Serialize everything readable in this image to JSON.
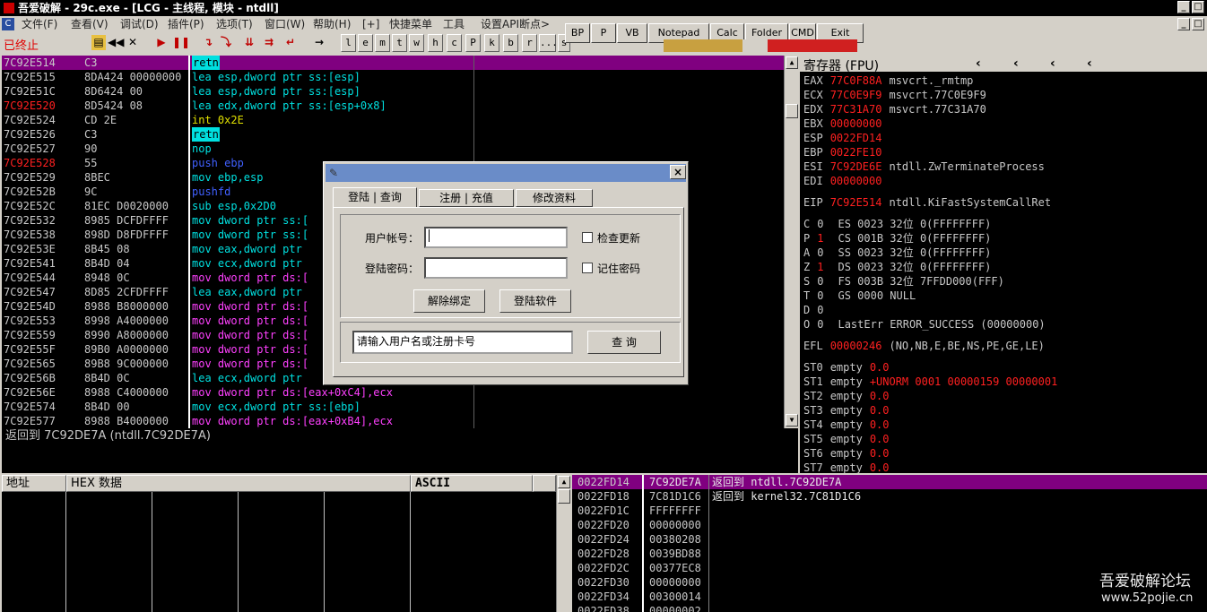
{
  "title": "吾爱破解 - 29c.exe - [LCG - 主线程, 模块 - ntdll]",
  "window_buttons": [
    "_",
    "□"
  ],
  "menu": [
    "文件(F)",
    "查看(V)",
    "调试(D)",
    "插件(P)",
    "选项(T)",
    "窗口(W)",
    "帮助(H)",
    "[+]",
    "快捷菜单",
    "工具",
    "设置API断点>"
  ],
  "status": "已终止",
  "quick_buttons": [
    "BP",
    "P",
    "VB",
    "Notepad",
    "Calc",
    "Folder",
    "CMD",
    "Exit"
  ],
  "letter_buttons": [
    "l",
    "e",
    "m",
    "t",
    "w",
    "h",
    "c",
    "P",
    "k",
    "b",
    "r",
    "...",
    "s"
  ],
  "disasm": [
    {
      "addr": "7C92E514",
      "hex": "C3",
      "asm": "retn",
      "addrColor": "#c8c8c8",
      "hl": "selected",
      "asmColor": "#000"
    },
    {
      "addr": "7C92E515",
      "hex": "8DA424 00000000",
      "asm": "lea esp,dword ptr ss:[esp]",
      "addrColor": "#c8c8c8",
      "asmColor": "#00e0e0"
    },
    {
      "addr": "7C92E51C",
      "hex": "8D6424 00",
      "asm": "lea esp,dword ptr ss:[esp]",
      "addrColor": "#c8c8c8",
      "asmColor": "#00e0e0"
    },
    {
      "addr": "7C92E520",
      "hex": "8D5424 08",
      "asm": "lea edx,dword ptr ss:[esp+0x8]",
      "addrColor": "#ff2020",
      "asmColor": "#00e0e0"
    },
    {
      "addr": "7C92E524",
      "hex": "CD 2E",
      "asm": "int 0x2E",
      "addrColor": "#c8c8c8",
      "asmColor": "#e0e000"
    },
    {
      "addr": "7C92E526",
      "hex": "C3",
      "asm": "retn",
      "addrColor": "#c8c8c8",
      "hl": "cyan",
      "asmColor": "#000"
    },
    {
      "addr": "7C92E527",
      "hex": "90",
      "asm": "nop",
      "addrColor": "#c8c8c8",
      "asmColor": "#00e0e0"
    },
    {
      "addr": "7C92E528",
      "hex": "55",
      "asm": "push ebp",
      "addrColor": "#ff2020",
      "asmColor": "#4060ff"
    },
    {
      "addr": "7C92E529",
      "hex": "8BEC",
      "asm": "mov ebp,esp",
      "addrColor": "#c8c8c8",
      "asmColor": "#00e0e0"
    },
    {
      "addr": "7C92E52B",
      "hex": "9C",
      "asm": "pushfd",
      "addrColor": "#c8c8c8",
      "asmColor": "#4060ff"
    },
    {
      "addr": "7C92E52C",
      "hex": "81EC D0020000",
      "asm": "sub esp,0x2D0",
      "addrColor": "#c8c8c8",
      "asmColor": "#00e0e0"
    },
    {
      "addr": "7C92E532",
      "hex": "8985 DCFDFFFF",
      "asm": "mov dword ptr ss:[",
      "addrColor": "#c8c8c8",
      "asmColor": "#00e0e0"
    },
    {
      "addr": "7C92E538",
      "hex": "898D D8FDFFFF",
      "asm": "mov dword ptr ss:[",
      "addrColor": "#c8c8c8",
      "asmColor": "#00e0e0"
    },
    {
      "addr": "7C92E53E",
      "hex": "8B45 08",
      "asm": "mov eax,dword ptr",
      "addrColor": "#c8c8c8",
      "asmColor": "#00e0e0"
    },
    {
      "addr": "7C92E541",
      "hex": "8B4D 04",
      "asm": "mov ecx,dword ptr",
      "addrColor": "#c8c8c8",
      "asmColor": "#00e0e0"
    },
    {
      "addr": "7C92E544",
      "hex": "8948 0C",
      "asm": "mov dword ptr ds:[",
      "addrColor": "#c8c8c8",
      "asmColor": "#ff40ff"
    },
    {
      "addr": "7C92E547",
      "hex": "8D85 2CFDFFFF",
      "asm": "lea eax,dword ptr",
      "addrColor": "#c8c8c8",
      "asmColor": "#00e0e0"
    },
    {
      "addr": "7C92E54D",
      "hex": "8988 B8000000",
      "asm": "mov dword ptr ds:[",
      "addrColor": "#c8c8c8",
      "asmColor": "#ff40ff"
    },
    {
      "addr": "7C92E553",
      "hex": "8998 A4000000",
      "asm": "mov dword ptr ds:[",
      "addrColor": "#c8c8c8",
      "asmColor": "#ff40ff"
    },
    {
      "addr": "7C92E559",
      "hex": "8990 A8000000",
      "asm": "mov dword ptr ds:[",
      "addrColor": "#c8c8c8",
      "asmColor": "#ff40ff"
    },
    {
      "addr": "7C92E55F",
      "hex": "89B0 A0000000",
      "asm": "mov dword ptr ds:[",
      "addrColor": "#c8c8c8",
      "asmColor": "#ff40ff"
    },
    {
      "addr": "7C92E565",
      "hex": "89B8 9C000000",
      "asm": "mov dword ptr ds:[",
      "addrColor": "#c8c8c8",
      "asmColor": "#ff40ff"
    },
    {
      "addr": "7C92E56B",
      "hex": "8B4D 0C",
      "asm": "lea ecx,dword ptr",
      "addrColor": "#c8c8c8",
      "asmColor": "#00e0e0"
    },
    {
      "addr": "7C92E56E",
      "hex": "8988 C4000000",
      "asm": "mov dword ptr ds:[eax+0xC4],ecx",
      "addrColor": "#c8c8c8",
      "asmColor": "#ff40ff"
    },
    {
      "addr": "7C92E574",
      "hex": "8B4D 00",
      "asm": "mov ecx,dword ptr ss:[ebp]",
      "addrColor": "#c8c8c8",
      "asmColor": "#00e0e0"
    },
    {
      "addr": "7C92E577",
      "hex": "8988 B4000000",
      "asm": "mov dword ptr ds:[eax+0xB4],ecx",
      "addrColor": "#c8c8c8",
      "asmColor": "#ff40ff"
    }
  ],
  "info_line": "返回到 7C92DE7A (ntdll.7C92DE7A)",
  "registers_title": "寄存器 (FPU)",
  "registers": [
    {
      "name": "EAX",
      "val": "77C0F88A",
      "note": "msvcrt._rmtmp"
    },
    {
      "name": "ECX",
      "val": "77C0E9F9",
      "note": "msvcrt.77C0E9F9"
    },
    {
      "name": "EDX",
      "val": "77C31A70",
      "note": "msvcrt.77C31A70"
    },
    {
      "name": "EBX",
      "val": "00000000",
      "note": ""
    },
    {
      "name": "ESP",
      "val": "0022FD14",
      "note": ""
    },
    {
      "name": "EBP",
      "val": "0022FE10",
      "note": ""
    },
    {
      "name": "ESI",
      "val": "7C92DE6E",
      "note": "ntdll.ZwTerminateProcess"
    },
    {
      "name": "EDI",
      "val": "00000000",
      "note": ""
    }
  ],
  "eip": {
    "name": "EIP",
    "val": "7C92E514",
    "note": "ntdll.KiFastSystemCallRet"
  },
  "flags": [
    {
      "f": "C",
      "v": "0",
      "rest": "ES 0023 32位 0(FFFFFFFF)",
      "red": false
    },
    {
      "f": "P",
      "v": "1",
      "rest": "CS 001B 32位 0(FFFFFFFF)",
      "red": true
    },
    {
      "f": "A",
      "v": "0",
      "rest": "SS 0023 32位 0(FFFFFFFF)",
      "red": false
    },
    {
      "f": "Z",
      "v": "1",
      "rest": "DS 0023 32位 0(FFFFFFFF)",
      "red": true
    },
    {
      "f": "S",
      "v": "0",
      "rest": "FS 003B 32位 7FFDD000(FFF)",
      "red": false
    },
    {
      "f": "T",
      "v": "0",
      "rest": "GS 0000 NULL",
      "red": false
    },
    {
      "f": "D",
      "v": "0",
      "rest": "",
      "red": false
    },
    {
      "f": "O",
      "v": "0",
      "rest": "LastErr ERROR_SUCCESS (00000000)",
      "red": false
    }
  ],
  "efl": {
    "name": "EFL",
    "val": "00000246",
    "note": "(NO,NB,E,BE,NS,PE,GE,LE)"
  },
  "fpu": [
    {
      "name": "ST0",
      "state": "empty",
      "val": "0.0"
    },
    {
      "name": "ST1",
      "state": "empty",
      "val": "+UNORM 0001 00000159 00000001"
    },
    {
      "name": "ST2",
      "state": "empty",
      "val": "0.0"
    },
    {
      "name": "ST3",
      "state": "empty",
      "val": "0.0"
    },
    {
      "name": "ST4",
      "state": "empty",
      "val": "0.0"
    },
    {
      "name": "ST5",
      "state": "empty",
      "val": "0.0"
    },
    {
      "name": "ST6",
      "state": "empty",
      "val": "0.0"
    },
    {
      "name": "ST7",
      "state": "empty",
      "val": "0.0"
    }
  ],
  "dump_headers": {
    "addr": "地址",
    "hex": "HEX 数据",
    "ascii": "ASCII"
  },
  "stack": [
    {
      "addr": "0022FD14",
      "val": "7C92DE7A",
      "note": "返回到 ntdll.7C92DE7A",
      "sel": true
    },
    {
      "addr": "0022FD18",
      "val": "7C81D1C6",
      "note": "返回到 kernel32.7C81D1C6",
      "sel": false
    },
    {
      "addr": "0022FD1C",
      "val": "FFFFFFFF",
      "note": "",
      "sel": false
    },
    {
      "addr": "0022FD20",
      "val": "00000000",
      "note": "",
      "sel": false
    },
    {
      "addr": "0022FD24",
      "val": "00380208",
      "note": "",
      "sel": false
    },
    {
      "addr": "0022FD28",
      "val": "0039BD88",
      "note": "",
      "sel": false
    },
    {
      "addr": "0022FD2C",
      "val": "00377EC8",
      "note": "",
      "sel": false
    },
    {
      "addr": "0022FD30",
      "val": "00000000",
      "note": "",
      "sel": false
    },
    {
      "addr": "0022FD34",
      "val": "00300014",
      "note": "",
      "sel": false
    },
    {
      "addr": "0022FD38",
      "val": "00000002",
      "note": "",
      "sel": false
    }
  ],
  "watermark": {
    "line1": "吾爱破解论坛",
    "line2": "www.52pojie.cn"
  },
  "dialog": {
    "tabs": [
      "登陆 | 查询",
      "注册 | 充值",
      "修改资料"
    ],
    "username_label": "用户帐号：",
    "password_label": "登陆密码：",
    "check_update": "检查更新",
    "remember_pwd": "记住密码",
    "unbind_button": "解除绑定",
    "login_button": "登陆软件",
    "query_placeholder": "请输入用户名或注册卡号",
    "query_button": "查 询",
    "close": "×"
  }
}
